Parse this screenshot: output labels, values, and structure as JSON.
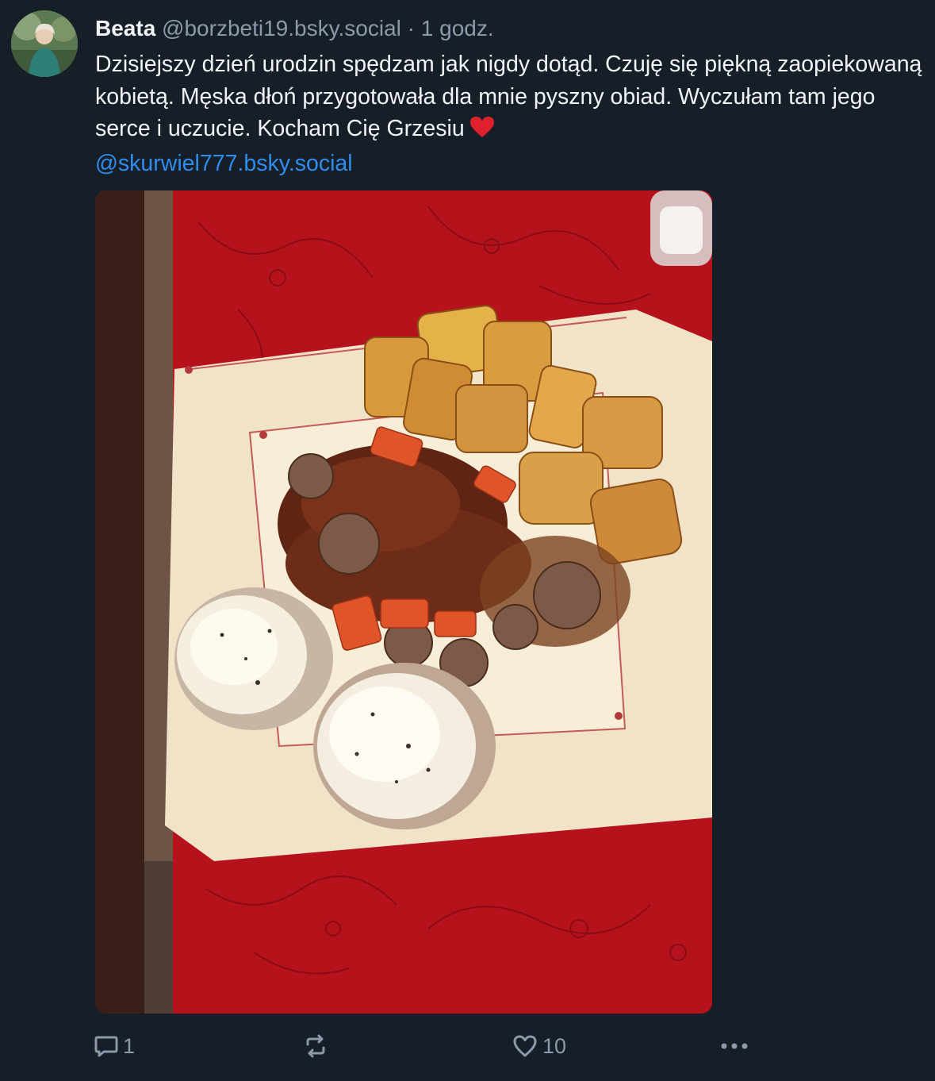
{
  "post": {
    "author_name": "Beata",
    "author_handle": "@borzbeti19.bsky.social",
    "separator": "·",
    "time": "1 godz.",
    "text": "Dzisiejszy dzień urodzin spędzam jak nigdy dotąd. Czuję się piękną zaopiekowaną kobietą. Męska dłoń przygotowała dla mnie pyszny obiad. Wyczułam tam jego serce i uczucie. Kocham Cię Grzesiu",
    "emoji": "heart-emoji",
    "mention": "@skurwiel777.bsky.social",
    "image": "photo of a plate with meat in gravy, roasted potatoes and baked stuffed mushrooms on a red tablecloth"
  },
  "actions": {
    "reply_count": "1",
    "repost_count": "",
    "like_count": "10",
    "more_icon": "ellipsis-icon"
  },
  "colors": {
    "background": "#161e27",
    "text": "#f1f3f5",
    "secondary_text": "#8c9aab",
    "link": "#2f8df0",
    "heart": "#e0202e"
  }
}
